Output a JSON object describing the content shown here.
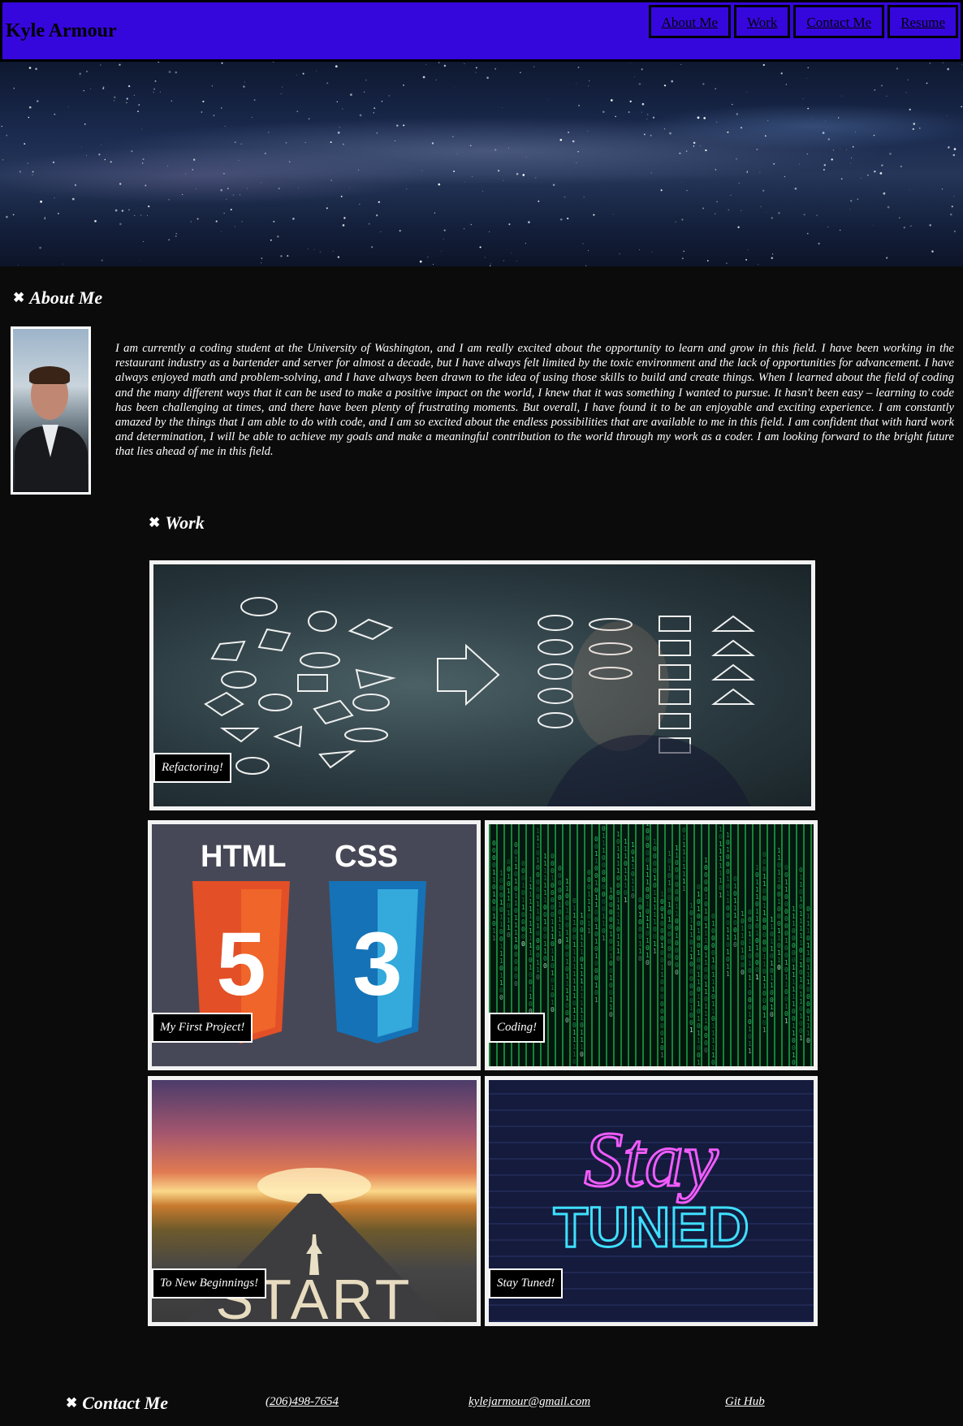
{
  "header": {
    "brand": "Kyle Armour",
    "nav": [
      "About Me",
      "Work",
      "Contact Me",
      "Resume"
    ]
  },
  "about": {
    "heading": "About Me",
    "heading_icon": "pin-icon",
    "text": "I am currently a coding student at the University of Washington, and I am really excited about the opportunity to learn and grow in this field. I have been working in the restaurant industry as a bartender and server for almost a decade, but I have always felt limited by the toxic environment and the lack of opportunities for advancement. I have always enjoyed math and problem-solving, and I have always been drawn to the idea of using those skills to build and create things. When I learned about the field of coding and the many different ways that it can be used to make a positive impact on the world, I knew that it was something I wanted to pursue. It hasn't been easy – learning to code has been challenging at times, and there have been plenty of frustrating moments. But overall, I have found it to be an enjoyable and exciting experience. I am constantly amazed by the things that I am able to do with code, and I am so excited about the endless possibilities that are available to me in this field. I am confident that with hard work and determination, I will be able to achieve my goals and make a meaningful contribution to the world through my work as a coder. I am looking forward to the bright future that lies ahead of me in this field."
  },
  "work": {
    "heading": "Work",
    "heading_icon": "pin-icon",
    "projects": [
      {
        "label": "Refactoring!"
      },
      {
        "label": "My First Project!",
        "art_text": [
          "HTML",
          "CSS",
          "5",
          "3"
        ]
      },
      {
        "label": "Coding!"
      },
      {
        "label": "To New Beginnings!",
        "art_text": "START"
      },
      {
        "label": "Stay Tuned!",
        "art_text": [
          "Stay",
          "TUNED"
        ]
      }
    ]
  },
  "contact": {
    "heading": "Contact Me",
    "heading_icon": "pin-icon",
    "phone": "(206)498-7654",
    "email": "kylejarmour@gmail.com",
    "github": "Git Hub"
  },
  "colors": {
    "header_bg": "#3607dc",
    "page_bg": "#0b0b0b",
    "card_border": "#f2f2f2"
  }
}
